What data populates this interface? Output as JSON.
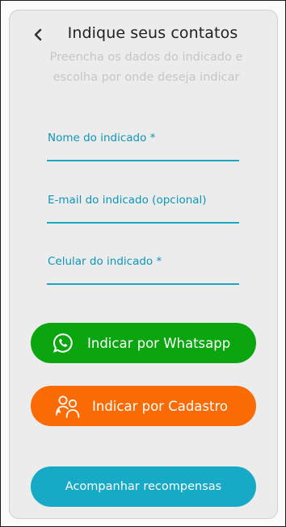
{
  "header": {
    "title": "Indique seus contatos",
    "subtitle_line1": "Preencha os dados do indicado e",
    "subtitle_line2": "escolha por onde deseja indicar"
  },
  "form": {
    "name_label": "Nome do indicado *",
    "email_label": "E-mail do indicado (opcional)",
    "phone_label": "Celular do indicado *"
  },
  "actions": {
    "whatsapp_label": "Indicar por Whatsapp",
    "cadastro_label": "Indicar por Cadastro",
    "rewards_label": "Acompanhar recompensas"
  },
  "icons": {
    "back": "chevron-left-icon",
    "whatsapp": "whatsapp-icon",
    "cadastro": "users-referral-icon"
  },
  "colors": {
    "field_accent": "#16a9c4",
    "whatsapp_button": "#0aa50f",
    "cadastro_button": "#fa6b06",
    "rewards_button": "#17aac7"
  }
}
